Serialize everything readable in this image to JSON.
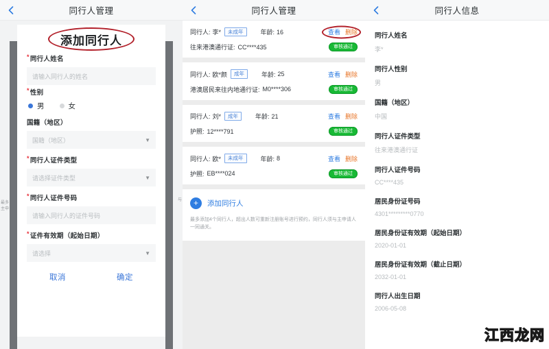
{
  "panel_add": {
    "nav": {
      "title": "同行人管理",
      "back_icon": "chevron-left-icon"
    },
    "card_title": "添加同行人",
    "fields": [
      {
        "label": "同行人姓名",
        "required": true,
        "type": "input",
        "value": "",
        "placeholder": "请输入同行人的姓名"
      },
      {
        "label": "性别",
        "required": true,
        "type": "radio",
        "options": [
          "男",
          "女"
        ],
        "selected": "男"
      },
      {
        "label": "国籍（地区）",
        "required": false,
        "type": "select",
        "value": "",
        "placeholder": "国籍（地区）"
      },
      {
        "label": "同行人证件类型",
        "required": true,
        "type": "select",
        "value": "",
        "placeholder": "请选择证件类型"
      },
      {
        "label": "同行人证件号码",
        "required": true,
        "type": "input",
        "value": "",
        "placeholder": "请输入同行人的证件号码"
      },
      {
        "label": "证件有效期（起始日期）",
        "required": true,
        "type": "select",
        "value": "",
        "placeholder": "请选择"
      }
    ],
    "cancel_label": "取消",
    "confirm_label": "确定",
    "ghost_left": "最多\n主申",
    "ghost_right": "与"
  },
  "panel_list": {
    "nav": {
      "title": "同行人管理",
      "back_icon": "chevron-left-icon"
    },
    "rows": [
      {
        "name_label": "同行人:",
        "name": "李*",
        "tag": "未成年",
        "age_label": "年龄:",
        "age": "16",
        "view_label": "查看",
        "delete_label": "删除",
        "doc_label": "往来港澳通行证:",
        "doc_no": "CC****435",
        "status": "审核通过",
        "highlighted": true
      },
      {
        "name_label": "同行人:",
        "name": "欧*颜",
        "tag": "成年",
        "age_label": "年龄:",
        "age": "25",
        "view_label": "查看",
        "delete_label": "删除",
        "doc_label": "港澳居民来往内地通行证:",
        "doc_no": "M0****306",
        "status": "审核通过",
        "highlighted": false
      },
      {
        "name_label": "同行人:",
        "name": "刘*",
        "tag": "成年",
        "age_label": "年龄:",
        "age": "21",
        "view_label": "查看",
        "delete_label": "删除",
        "doc_label": "护照:",
        "doc_no": "12****791",
        "status": "审核通过",
        "highlighted": false
      },
      {
        "name_label": "同行人:",
        "name": "欧*",
        "tag": "未成年",
        "age_label": "年龄:",
        "age": "8",
        "view_label": "查看",
        "delete_label": "删除",
        "doc_label": "护照:",
        "doc_no": "EB****024",
        "status": "审核通过",
        "highlighted": false
      }
    ],
    "add_label": "添加同行人",
    "add_icon": "plus-icon",
    "note": "最多添加4个同行人，超出人数可重新注册账号进行预约，同行人须与主申请人一同通关。"
  },
  "panel_detail": {
    "nav": {
      "title": "同行人信息",
      "back_icon": "chevron-left-icon"
    },
    "items": [
      {
        "label": "同行人姓名",
        "value": "李*"
      },
      {
        "label": "同行人性别",
        "value": "男"
      },
      {
        "label": "国籍（地区）",
        "value": "中国"
      },
      {
        "label": "同行人证件类型",
        "value": "往来港澳通行证"
      },
      {
        "label": "同行人证件号码",
        "value": "CC****435"
      },
      {
        "label": "居民身份证号码",
        "value": "4301*********0770"
      },
      {
        "label": "居民身份证有效期（起始日期）",
        "value": "2020-01-01"
      },
      {
        "label": "居民身份证有效期（截止日期）",
        "value": "2032-01-01"
      },
      {
        "label": "同行人出生日期",
        "value": "2006-05-08"
      }
    ]
  },
  "watermark": "江西龙网",
  "colors": {
    "accent_blue": "#2f7de1",
    "delete_orange": "#e8762a",
    "annotation_red": "#b2202a",
    "status_green": "#18b935",
    "required_red": "#e8303a"
  }
}
